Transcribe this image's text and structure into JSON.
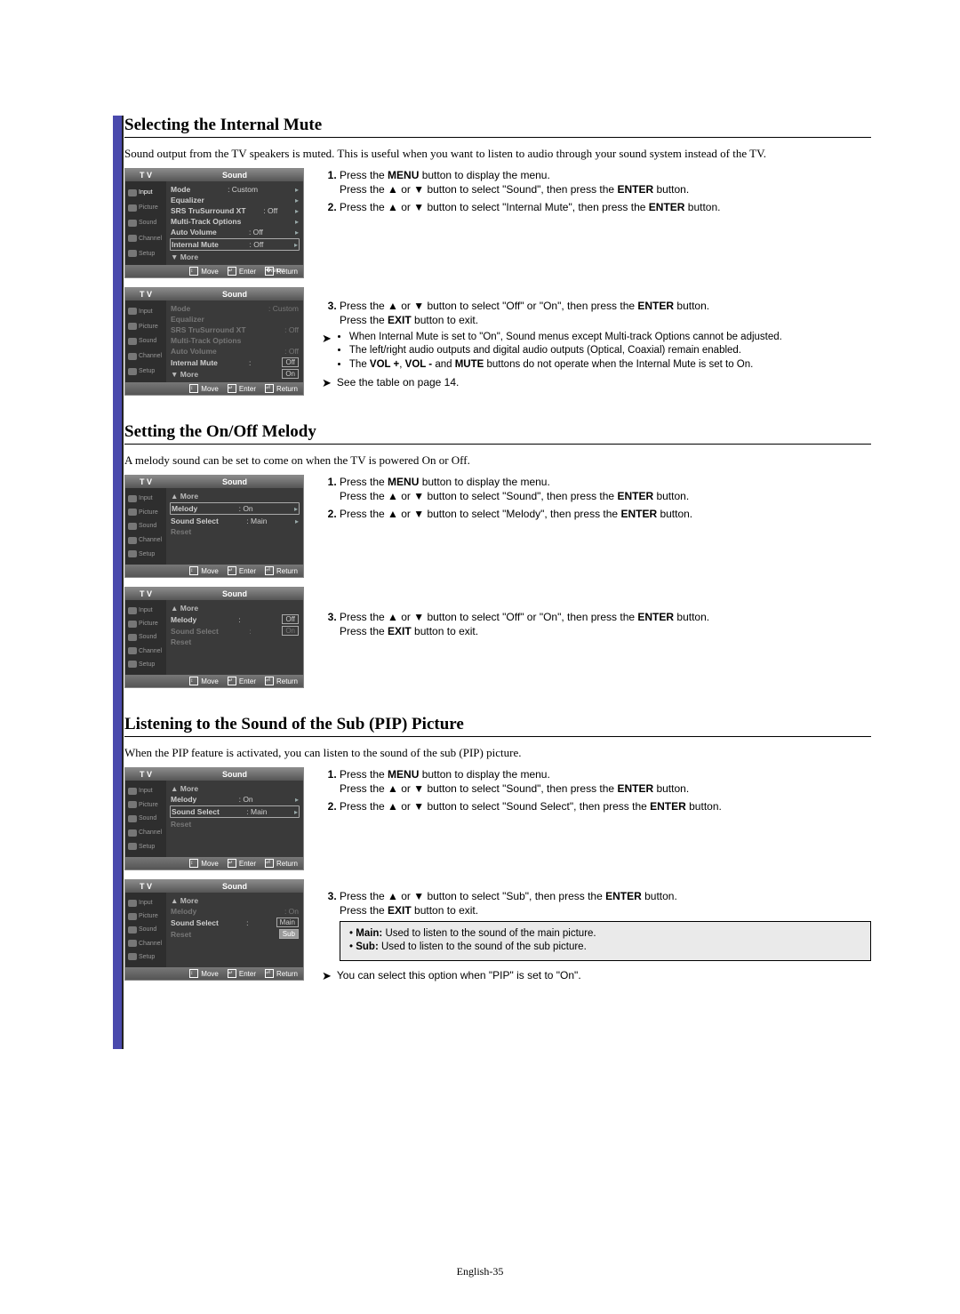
{
  "page_number": "English-35",
  "osd_footer": {
    "move": "Move",
    "enter": "Enter",
    "return": "Return",
    "tv": "T V"
  },
  "nav": {
    "input": "Input",
    "picture": "Picture",
    "sound": "Sound",
    "channel": "Channel",
    "setup": "Setup"
  },
  "section1": {
    "heading": "Selecting the Internal Mute",
    "intro": "Sound output from the TV speakers is muted. This is useful when you want to listen to audio through your sound system instead of the TV.",
    "osd_title": "Sound",
    "osd1": {
      "rows": {
        "mode": {
          "label": "Mode",
          "val": ": Custom"
        },
        "eq": {
          "label": "Equalizer",
          "val": ""
        },
        "srs": {
          "label": "SRS TruSurround XT",
          "val": ": Off"
        },
        "mto": {
          "label": "Multi-Track Options",
          "val": ""
        },
        "av": {
          "label": "Auto Volume",
          "val": ": Off"
        },
        "im": {
          "label": "Internal Mute",
          "val": ": Off"
        },
        "more": {
          "label": "▼ More",
          "val": ""
        }
      }
    },
    "osd2": {
      "rows": {
        "mode": {
          "label": "Mode",
          "val": ": Custom"
        },
        "eq": {
          "label": "Equalizer",
          "val": ""
        },
        "srs": {
          "label": "SRS TruSurround XT",
          "val": ": Off"
        },
        "mto": {
          "label": "Multi-Track Options",
          "val": ""
        },
        "av": {
          "label": "Auto Volume",
          "val": ": Off"
        },
        "im": {
          "label": "Internal Mute",
          "val": ":"
        },
        "im_sel": {
          "opt1": "Off",
          "opt2": "On"
        },
        "more": {
          "label": "▼ More",
          "val": ""
        }
      }
    },
    "steps": {
      "s1a": "Press the ",
      "s1b": "MENU",
      "s1c": " button to display the menu.",
      "s1d": "Press the ▲ or ▼ button to select \"Sound\", then press the ",
      "s1e": "ENTER",
      "s1f": " button.",
      "s2a": "Press the ▲ or ▼ button to select \"Internal Mute\", then press the ",
      "s2b": "ENTER",
      "s2c": " button.",
      "s3a": "Press the ▲ or ▼ button to select \"Off\" or \"On\", then press the ",
      "s3b": "ENTER",
      "s3c": " button.",
      "s3d": "Press the ",
      "s3e": "EXIT",
      "s3f": " button to exit."
    },
    "notes": {
      "n1": "When Internal Mute is set to \"On\", Sound menus except Multi-track Options cannot be adjusted.",
      "n2": "The left/right audio outputs and digital audio outputs (Optical, Coaxial) remain enabled.",
      "n3a": "The ",
      "n3b": "VOL +",
      "n3c": ", ",
      "n3d": "VOL -",
      "n3e": " and ",
      "n3f": "MUTE",
      "n3g": " buttons do not operate when the Internal Mute is set to On.",
      "n4": "See the table on page 14."
    }
  },
  "section2": {
    "heading": "Setting the On/Off Melody",
    "intro": "A melody sound can be set to come on when the TV is powered On or Off.",
    "osd_title": "Sound",
    "osd1": {
      "rows": {
        "more": {
          "label": "▲ More"
        },
        "melody": {
          "label": "Melody",
          "val": ": On"
        },
        "ss": {
          "label": "Sound Select",
          "val": ": Main"
        },
        "reset": {
          "label": "Reset"
        }
      }
    },
    "osd2": {
      "rows": {
        "more": {
          "label": "▲ More"
        },
        "melody": {
          "label": "Melody",
          "val": ":"
        },
        "melody_sel": {
          "opt1": "Off",
          "opt2": "On"
        },
        "ss": {
          "label": "Sound Select",
          "val": ":"
        },
        "reset": {
          "label": "Reset"
        }
      }
    },
    "steps": {
      "s1a": "Press the ",
      "s1b": "MENU",
      "s1c": " button to display the menu.",
      "s1d": "Press the ▲ or ▼ button to select \"Sound\", then press the ",
      "s1e": "ENTER",
      "s1f": " button.",
      "s2a": "Press the ▲ or ▼ button to select \"Melody\", then press the ",
      "s2b": "ENTER",
      "s2c": " button.",
      "s3a": "Press the ▲ or ▼ button to select \"Off\" or \"On\", then press the ",
      "s3b": "ENTER",
      "s3c": " button.",
      "s3d": "Press the ",
      "s3e": "EXIT",
      "s3f": " button to exit."
    }
  },
  "section3": {
    "heading": "Listening to the Sound of the Sub (PIP) Picture",
    "intro": "When the PIP feature is activated, you can listen to the sound of the sub (PIP) picture.",
    "osd_title": "Sound",
    "osd1": {
      "rows": {
        "more": {
          "label": "▲ More"
        },
        "melody": {
          "label": "Melody",
          "val": ": On"
        },
        "ss": {
          "label": "Sound Select",
          "val": ": Main"
        },
        "reset": {
          "label": "Reset"
        }
      }
    },
    "osd2": {
      "rows": {
        "more": {
          "label": "▲ More"
        },
        "melody": {
          "label": "Melody",
          "val": ": On"
        },
        "ss": {
          "label": "Sound Select",
          "val": ":"
        },
        "ss_sel": {
          "opt1": "Main",
          "opt2": "Sub"
        },
        "reset": {
          "label": "Reset"
        }
      }
    },
    "steps": {
      "s1a": "Press the ",
      "s1b": "MENU",
      "s1c": " button to display the menu.",
      "s1d": "Press the ▲ or ▼ button to select \"Sound\", then press the ",
      "s1e": "ENTER",
      "s1f": " button.",
      "s2a": "Press the ▲ or ▼ button to select \"Sound Select\", then press the ",
      "s2b": "ENTER",
      "s2c": " button.",
      "s3a": "Press the ▲ or ▼ button to select \"Sub\", then press the ",
      "s3b": "ENTER",
      "s3c": " button.",
      "s3d": "Press the ",
      "s3e": "EXIT",
      "s3f": " button to exit."
    },
    "box": {
      "l1a": "Main:",
      "l1b": " Used to listen to the sound of the main picture.",
      "l2a": "Sub:",
      "l2b": " Used to listen to the sound of the sub picture."
    },
    "note": "You can select this option when \"PIP\" is set to \"On\"."
  }
}
